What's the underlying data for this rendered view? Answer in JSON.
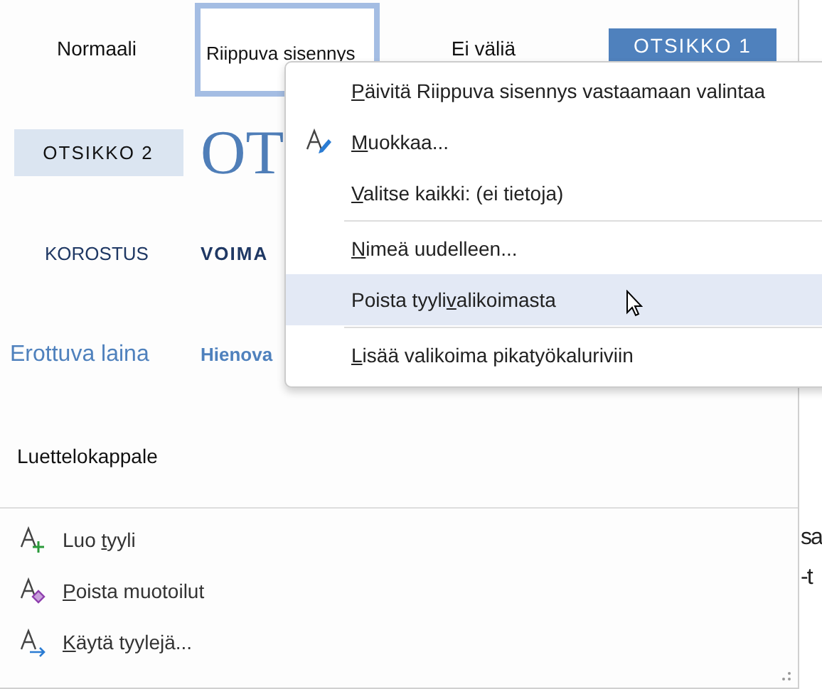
{
  "gallery": {
    "rows": [
      [
        {
          "label": "Normaali",
          "kind": "plain",
          "selected": false
        },
        {
          "label": "Riippuva sisennys",
          "kind": "plain",
          "selected": true
        },
        {
          "label": "Ei väliä",
          "kind": "plain",
          "selected": false
        },
        {
          "label": "OTSIKKO 1",
          "kind": "heading1",
          "selected": false
        }
      ],
      [
        {
          "label": "OTSIKKO 2",
          "kind": "heading2",
          "selected": false
        },
        {
          "label": "OT",
          "kind": "title",
          "selected": false
        }
      ],
      [
        {
          "label": "KOROSTUS",
          "kind": "emphasis",
          "selected": false
        },
        {
          "label": "VOIMA",
          "kind": "strong",
          "selected": false
        }
      ],
      [
        {
          "label": "Erottuva laina",
          "kind": "quote",
          "selected": false
        },
        {
          "label": "Hienova",
          "kind": "subtle",
          "selected": false
        }
      ],
      [
        {
          "label": "Luettelokappale",
          "kind": "plain",
          "selected": false
        }
      ]
    ]
  },
  "commands": [
    {
      "pre": "Luo ",
      "key": "t",
      "post": "yyli"
    },
    {
      "key": "P",
      "post": "oista muotoilut"
    },
    {
      "key": "K",
      "post": "äytä tyylejä..."
    }
  ],
  "document": {
    "lines": [
      "sa",
      "-t"
    ]
  },
  "context_menu": {
    "items": [
      {
        "kind": "text",
        "key": "P",
        "post": "äivitä Riippuva sisennys vastaamaan valintaa",
        "selected": false,
        "separator_after": false
      },
      {
        "kind": "icon",
        "key": "M",
        "post": "uokkaa...",
        "selected": false,
        "separator_after": false
      },
      {
        "kind": "text",
        "key": "V",
        "post": "alitse kaikki: (ei tietoja)",
        "selected": false,
        "separator_after": true
      },
      {
        "kind": "text",
        "key": "N",
        "post": "imeä uudelleen...",
        "selected": false,
        "separator_after": false
      },
      {
        "kind": "text",
        "pre": "Poista tyyli",
        "key": "v",
        "post": "alikoimasta",
        "selected": true,
        "separator_after": true
      },
      {
        "kind": "text",
        "key": "L",
        "post": "isää valikoima pikatyökaluriviin",
        "selected": false,
        "separator_after": false
      }
    ]
  }
}
